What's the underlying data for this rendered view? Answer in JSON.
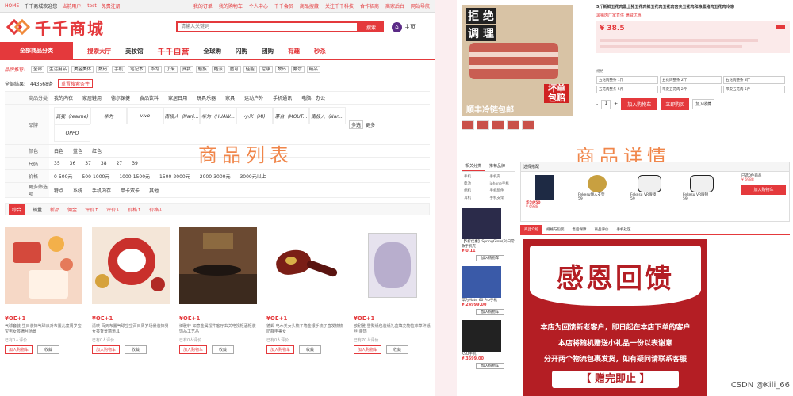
{
  "left": {
    "topbar": {
      "home": "HOME",
      "welcome": "千千商城欢迎您",
      "current_user_label": "当前用户:",
      "user": "test",
      "register": "免费注册",
      "links": [
        "我的订单",
        "我的购物车",
        "个人中心",
        "千千会员",
        "商品搜藏",
        "关注千千科技",
        "合作招商",
        "商家后台",
        "网站导航"
      ]
    },
    "logo_text": "千千商城",
    "search": {
      "placeholder": "请输入关键词",
      "button": "搜索"
    },
    "home_button": "主页",
    "nav": {
      "all_categories": "全部商品分类",
      "items": [
        "搜索大厅",
        "美妆馆",
        "千千自营",
        "全球购",
        "闪购",
        "团购",
        "有趣",
        "秒杀"
      ]
    },
    "brandbar": {
      "label": "品牌推荐:",
      "brands": [
        "全部",
        "生活用品",
        "美容美体",
        "数码",
        "手机",
        "笔记本",
        "华为",
        "小米",
        "真我",
        "魅族",
        "酷派",
        "魔可",
        "佳能",
        "尼康",
        "数码",
        "戴尔",
        "精品"
      ]
    },
    "found": {
      "prefix": "全部结果:",
      "count": "443568条",
      "reset": "重置搜索条件"
    },
    "filters": {
      "category": {
        "key": "商品分类",
        "values": [
          "我的内衣",
          "家居鞋用",
          "德尔保健",
          "食品饮料",
          "家居日用",
          "玩具乐器",
          "家具",
          "运动户外",
          "手机通讯",
          "电脑、办公"
        ]
      },
      "brand": {
        "key": "品牌",
        "values": [
          "真我（realme)",
          "华为",
          "vivo",
          "南极人（Nanj...",
          "华为（HUAW...",
          "小米（MI)",
          "茅台（MOUT...",
          "南极人（Nan...",
          "OPPO"
        ],
        "more": "多选",
        "more2": "更多"
      },
      "color": {
        "key": "颜色",
        "values": [
          "白色",
          "蓝色",
          "红色"
        ]
      },
      "size": {
        "key": "尺码",
        "values": [
          "35",
          "36",
          "37",
          "38",
          "27",
          "39"
        ]
      },
      "price": {
        "key": "价格",
        "values": [
          "0-500元",
          "500-1000元",
          "1000-1500元",
          "1500-2000元",
          "2000-3000元",
          "3000元以上"
        ]
      },
      "more_opts": {
        "key": "更多筛选项",
        "values": [
          "特点",
          "系统",
          "手机内存",
          "单卡双卡",
          "其他"
        ]
      }
    },
    "watermark": "商品列表",
    "sort": [
      "综合",
      "销量",
      "新品",
      "佣金",
      "评价↑",
      "评价↓",
      "价格↑",
      "价格↓"
    ],
    "products": [
      {
        "price": "¥OE+1",
        "desc": "气球套装 生日装饰气球派对布置儿童周岁宝宝男女孩满月场景",
        "eval": "已有0人评价",
        "cart": "加入购物车",
        "fav": "收藏"
      },
      {
        "price": "¥OE+1",
        "desc": "清瑛 百天布置气球宝宝百日周岁场景装饰男女孩背景墙道具",
        "eval": "已有0人评价",
        "cart": "加入购物车",
        "fav": "收藏"
      },
      {
        "price": "¥OE+1",
        "desc": "博雅轩 如意金属摆件客厅玄关电视柜酒柜装饰品工艺品",
        "eval": "已有0人评价",
        "cart": "加入购物车",
        "fav": "收藏"
      },
      {
        "price": "¥OE+1",
        "desc": "德蝎 电木美女头梳子墙金银手梳子直发梳梳防静电美女",
        "eval": "已有0人评价",
        "cart": "加入购物车",
        "fav": "收藏"
      },
      {
        "price": "¥OE+1",
        "desc": "欧耐雅 雪梨纸包装纸礼盒填充物拉菲草碎纸丝 装饰",
        "eval": "已有70人评价",
        "cart": "加入购物车",
        "fav": "收藏"
      }
    ]
  },
  "right": {
    "main_image_text": {
      "l1": "拒 绝",
      "l2": "调 理",
      "tag": "坏单包赔",
      "bottom": "顺丰冷链包邮"
    },
    "title": "5斤新鲜五花肉黑土猪五花肉鲜五花肉五花肉宫夫五花肉和粮黑猪肉五花肉冷冻",
    "subtitle": "黑猪肉厂家直供 满减优惠",
    "price": "¥ 38.5",
    "spec_label": "规格",
    "specs": [
      "五花肉整条 1斤",
      "五花肉整条 2斤",
      "五花肉整条 3斤",
      "五花肉整条 5斤",
      "带皮五花肉 2斤",
      "带皮五花肉 5斤"
    ],
    "actions": {
      "qty": "1",
      "cart": "加入购物车",
      "buy": "立即购买",
      "fav": "加入收藏"
    },
    "watermark": "商品详情",
    "side_tabs": [
      "相关分类",
      "推荐品牌"
    ],
    "side_cats": [
      "手机",
      "手机壳",
      "电池",
      "iphone手机",
      "相机",
      "手机配件",
      "耳机",
      "手机支架"
    ],
    "side_products": [
      {
        "desc": "【5折优惠】SpringGlow(B)日常款手机壳",
        "price": "¥ 0.11",
        "btn": "加入购物车"
      },
      {
        "desc": "华为Mate 60 Pro手机",
        "price": "¥ 24999.00",
        "btn": "加入购物车"
      },
      {
        "desc": "KSO手机",
        "price": "¥ 3599.00",
        "btn": "加入购物车"
      }
    ],
    "combo": {
      "head": "选择搭配",
      "items": [
        {
          "name": "华为P50",
          "price": "¥ 6988"
        },
        {
          "name": "Fekesu懒人支架",
          "price": "59"
        },
        {
          "name": "Fekesu VR眼镜",
          "price": "59"
        },
        {
          "name": "Fekesu VR眼镜",
          "price": "59"
        }
      ],
      "total_label": "已选0件商品",
      "total": "¥ 6988",
      "btn": "加入购物车"
    },
    "detail_tabs": [
      "商品介绍",
      "规格与包装",
      "售后保障",
      "商品评价",
      "手机社区"
    ],
    "banner": {
      "title": "感恩回馈",
      "l1": "本店为回馈新老客户，即日起在本店下单的客户",
      "l2": "本店将随机赠送小礼品一份以表谢意",
      "l3": "分开两个物流包裹发货，如有疑问请联系客服",
      "cta": "【 赠完即止 】"
    }
  },
  "credit": "CSDN @Kili_66"
}
